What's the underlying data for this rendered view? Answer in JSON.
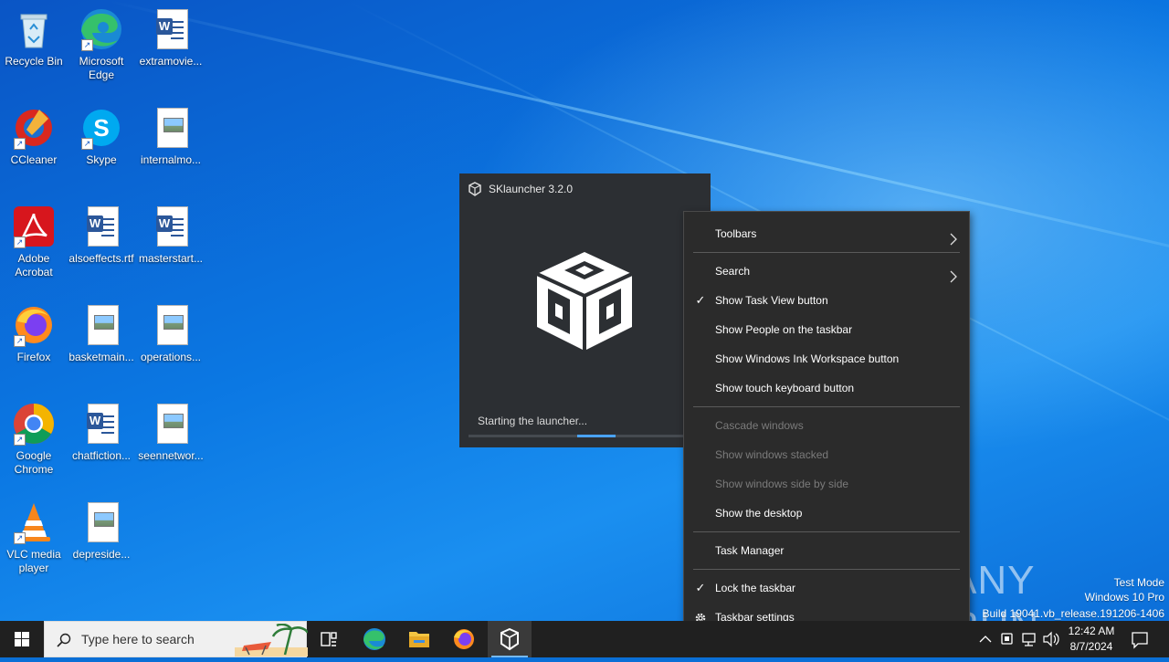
{
  "desktop": {
    "icons": [
      {
        "label": "Recycle Bin"
      },
      {
        "label": "Microsoft Edge"
      },
      {
        "label": "extramovie..."
      },
      {
        "label": "CCleaner"
      },
      {
        "label": "Skype"
      },
      {
        "label": "internalmo..."
      },
      {
        "label": "Adobe Acrobat"
      },
      {
        "label": "alsoeffects.rtf"
      },
      {
        "label": "masterstart..."
      },
      {
        "label": "Firefox"
      },
      {
        "label": "basketmain..."
      },
      {
        "label": "operations..."
      },
      {
        "label": "Google Chrome"
      },
      {
        "label": "chatfiction..."
      },
      {
        "label": "seennetwor..."
      },
      {
        "label": "VLC media player"
      },
      {
        "label": "depreside..."
      }
    ]
  },
  "sklauncher": {
    "title": "SKlauncher 3.2.0",
    "status": "Starting the launcher...",
    "progress_color": "#4aa3ff"
  },
  "context_menu": {
    "items": [
      {
        "label": "Toolbars",
        "submenu": true
      },
      {
        "label": "Search",
        "submenu": true
      },
      {
        "label": "Show Task View button",
        "checked": true
      },
      {
        "label": "Show People on the taskbar"
      },
      {
        "label": "Show Windows Ink Workspace button"
      },
      {
        "label": "Show touch keyboard button"
      },
      {
        "label": "Cascade windows",
        "disabled": true
      },
      {
        "label": "Show windows stacked",
        "disabled": true
      },
      {
        "label": "Show windows side by side",
        "disabled": true
      },
      {
        "label": "Show the desktop"
      },
      {
        "label": "Task Manager"
      },
      {
        "label": "Lock the taskbar",
        "checked": true
      },
      {
        "label": "Taskbar settings",
        "icon": "gear-icon"
      }
    ],
    "check_glyph": "✓"
  },
  "watermark": {
    "text": "ANY RUN",
    "test_mode": "Test Mode",
    "edition": "Windows 10 Pro",
    "build": "Build 19041.vb_release.191206-1406"
  },
  "taskbar": {
    "search_placeholder": "Type here to search",
    "time": "12:42 AM",
    "date": "8/7/2024",
    "background_color": "#202020"
  }
}
